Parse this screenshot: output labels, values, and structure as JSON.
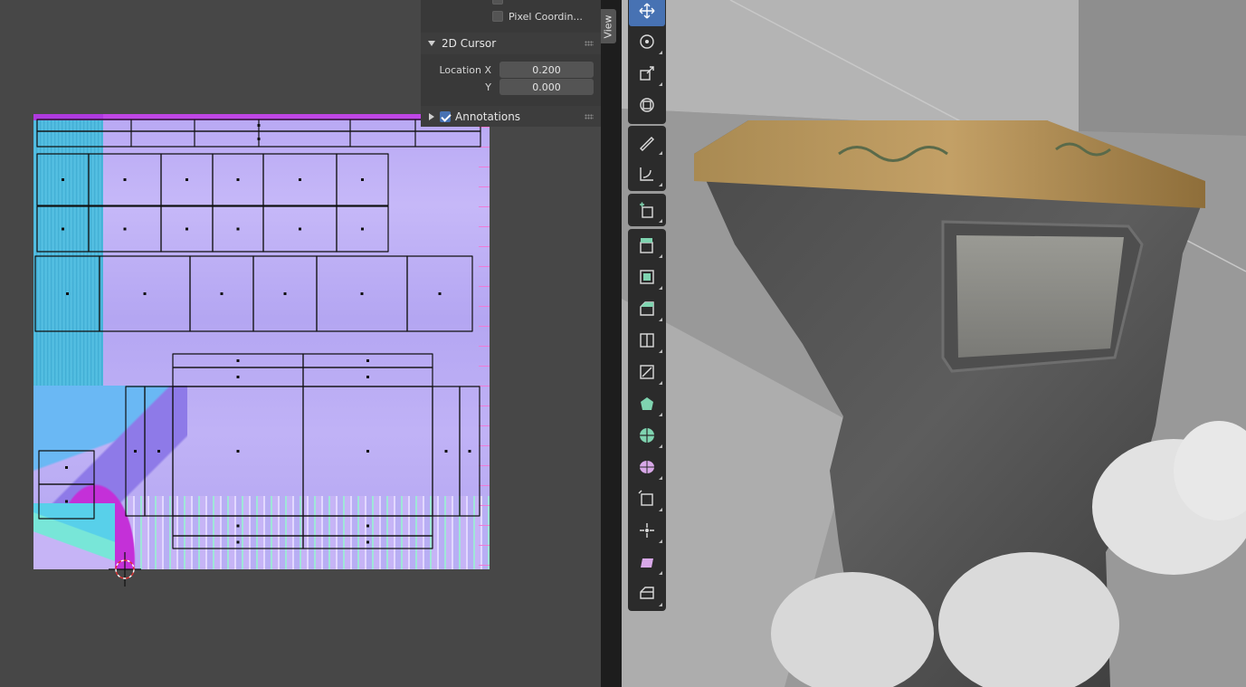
{
  "sidebar": {
    "checkbox_top": {
      "label": "",
      "checked": false
    },
    "pixel_coords": {
      "label": "Pixel Coordin...",
      "checked": false
    },
    "cursor_panel": {
      "title": "2D Cursor",
      "location_x_label": "Location X",
      "location_x_value": "0.200",
      "y_label": "Y",
      "y_value": "0.000"
    },
    "annotations": {
      "label": "Annotations",
      "checked": true
    }
  },
  "view_tab": {
    "label": "View"
  },
  "toolbar": {
    "tools": [
      {
        "name": "move",
        "icon": "move-icon",
        "active": true
      },
      {
        "name": "rotate",
        "icon": "rotate-icon"
      },
      {
        "name": "scale",
        "icon": "scale-icon"
      },
      {
        "name": "transform",
        "icon": "transform-icon"
      },
      {
        "name": "annotate",
        "icon": "annotate-icon"
      },
      {
        "name": "measure",
        "icon": "measure-icon"
      },
      {
        "name": "add-cube",
        "icon": "add-cube-icon"
      },
      {
        "name": "extrude",
        "icon": "extrude-icon"
      },
      {
        "name": "inset",
        "icon": "inset-icon"
      },
      {
        "name": "bevel",
        "icon": "bevel-icon"
      },
      {
        "name": "loop-cut",
        "icon": "loop-cut-icon"
      },
      {
        "name": "knife",
        "icon": "knife-icon"
      },
      {
        "name": "poly-build",
        "icon": "poly-build-icon"
      },
      {
        "name": "spin",
        "icon": "spin-icon"
      },
      {
        "name": "smooth",
        "icon": "smooth-icon"
      },
      {
        "name": "edge-slide",
        "icon": "edge-slide-icon"
      },
      {
        "name": "shrink-fatten",
        "icon": "shrink-fatten-icon"
      },
      {
        "name": "shear",
        "icon": "shear-icon"
      },
      {
        "name": "rip",
        "icon": "rip-icon"
      }
    ]
  },
  "colors": {
    "active_tool": "#4772b3",
    "uv_wire": "#111111",
    "panel_bg": "#393939"
  }
}
